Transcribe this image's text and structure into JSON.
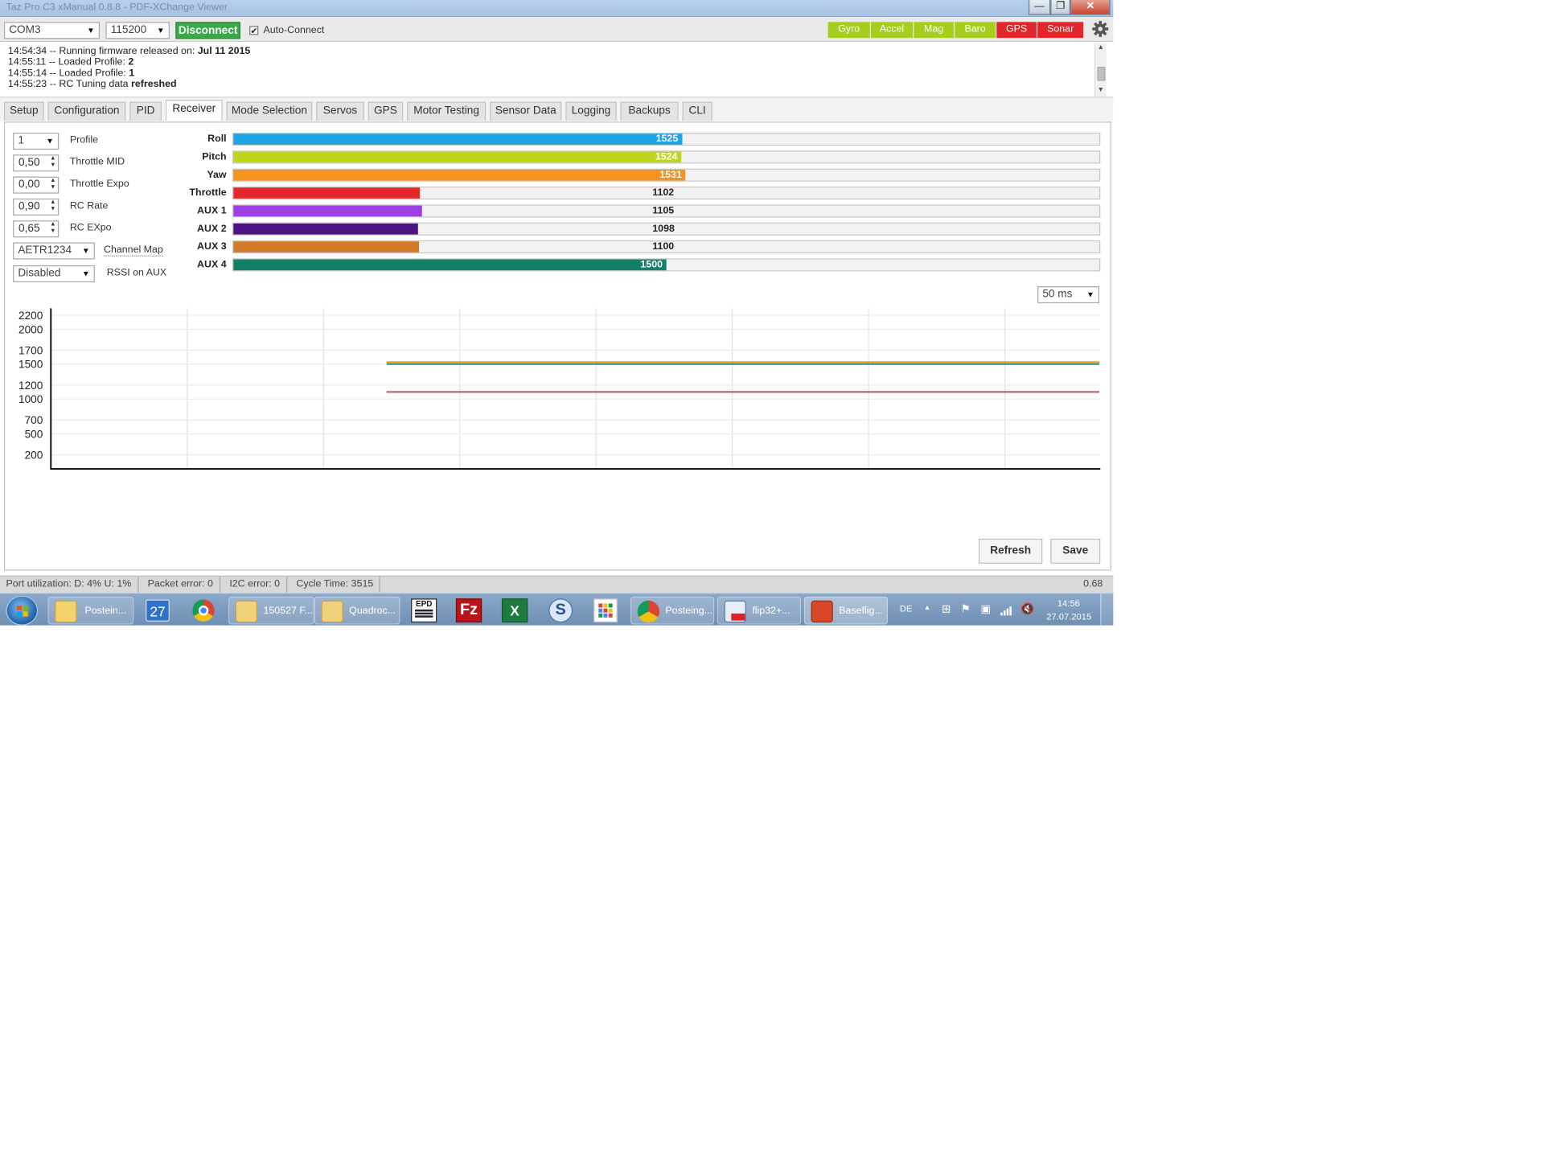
{
  "window": {
    "title": "Taz Pro C3 xManual 0.8.8 - PDF-XChange Viewer",
    "min_label": "—",
    "max_label": "❐",
    "close_label": "✕"
  },
  "toolbar": {
    "port": "COM3",
    "baud": "115200",
    "disconnect_label": "Disconnect",
    "autoconnect_label": "Auto-Connect",
    "autoconnect_checked": "✔",
    "sensors": [
      {
        "label": "Gyro",
        "state": "on",
        "color": "#a5cf1c"
      },
      {
        "label": "Accel",
        "state": "on",
        "color": "#a5cf1c"
      },
      {
        "label": "Mag",
        "state": "on",
        "color": "#a5cf1c"
      },
      {
        "label": "Baro",
        "state": "on",
        "color": "#a5cf1c"
      },
      {
        "label": "GPS",
        "state": "off",
        "color": "#e2262a"
      },
      {
        "label": "Sonar",
        "state": "off",
        "color": "#e2262a"
      }
    ],
    "settings_icon": "gear-icon"
  },
  "log": {
    "lines": [
      {
        "text": "14:54:34 -- Running firmware released on: ",
        "bold": "Jul 11 2015"
      },
      {
        "text": "14:55:11 -- Loaded Profile: ",
        "bold": "2"
      },
      {
        "text": "14:55:14 -- Loaded Profile: ",
        "bold": "1"
      },
      {
        "text": "14:55:23 -- RC Tuning data ",
        "bold": "refreshed"
      }
    ]
  },
  "tabs": [
    {
      "label": "Setup",
      "active": false
    },
    {
      "label": "Configuration",
      "active": false
    },
    {
      "label": "PID",
      "active": false
    },
    {
      "label": "Receiver",
      "active": true
    },
    {
      "label": "Mode Selection",
      "active": false
    },
    {
      "label": "Servos",
      "active": false
    },
    {
      "label": "GPS",
      "active": false
    },
    {
      "label": "Motor Testing",
      "active": false
    },
    {
      "label": "Sensor Data",
      "active": false
    },
    {
      "label": "Logging",
      "active": false
    },
    {
      "label": "Backups",
      "active": false
    },
    {
      "label": "CLI",
      "active": false
    }
  ],
  "settings": {
    "profile": {
      "value": "1",
      "label": "Profile"
    },
    "throttle_mid": {
      "value": "0,50",
      "label": "Throttle MID"
    },
    "throttle_expo": {
      "value": "0,00",
      "label": "Throttle Expo"
    },
    "rc_rate": {
      "value": "0,90",
      "label": "RC Rate"
    },
    "rc_expo": {
      "value": "0,65",
      "label": "RC EXpo"
    },
    "channel_map": {
      "value": "AETR1234",
      "label": "Channel Map"
    },
    "rssi": {
      "value": "Disabled",
      "label": "RSSI on AUX"
    }
  },
  "channels": {
    "min": 1000,
    "max": 2000,
    "items": [
      {
        "label": "Roll",
        "value": 1525,
        "color": "#1ea3e3"
      },
      {
        "label": "Pitch",
        "value": 1524,
        "color": "#c0d51a"
      },
      {
        "label": "Yaw",
        "value": 1531,
        "color": "#f6931e"
      },
      {
        "label": "Throttle",
        "value": 1102,
        "color": "#e5292b"
      },
      {
        "label": "AUX 1",
        "value": 1105,
        "color": "#9b3fe0"
      },
      {
        "label": "AUX 2",
        "value": 1098,
        "color": "#4a1580"
      },
      {
        "label": "AUX 3",
        "value": 1100,
        "color": "#d07a2a"
      },
      {
        "label": "AUX 4",
        "value": 1500,
        "color": "#14806a"
      }
    ]
  },
  "refresh_rate": "50 ms",
  "chart_data": {
    "type": "line",
    "title": "",
    "xlabel": "",
    "ylabel": "",
    "y_ticks": [
      "2200",
      "2000",
      "1700",
      "1500",
      "1200",
      "1000",
      "700",
      "500",
      "200"
    ],
    "ylim": [
      0,
      2300
    ],
    "grid": true,
    "x_start_fraction": 0.32,
    "series": [
      {
        "label": "Roll",
        "color": "#1ea3e3",
        "value": 1525
      },
      {
        "label": "Pitch",
        "color": "#c0d51a",
        "value": 1524
      },
      {
        "label": "Yaw",
        "color": "#f6931e",
        "value": 1531
      },
      {
        "label": "Throttle",
        "color": "#e5292b",
        "value": 1102
      },
      {
        "label": "AUX 1",
        "color": "#9b3fe0",
        "value": 1105
      },
      {
        "label": "AUX 2",
        "color": "#4a1580",
        "value": 1098
      },
      {
        "label": "AUX 3",
        "color": "#d07a2a",
        "value": 1100
      },
      {
        "label": "AUX 4",
        "color": "#14806a",
        "value": 1500
      }
    ]
  },
  "buttons": {
    "refresh": "Refresh",
    "save": "Save"
  },
  "status": {
    "port_util": "Port utilization: D: 4% U: 1%",
    "packet_error": "Packet error: 0",
    "i2c_error": "I2C error: 0",
    "cycle_time": "Cycle Time: 3515",
    "version": "0.68"
  },
  "taskbar": {
    "items": [
      {
        "label": "Postein...",
        "icon": "outlook-icon"
      },
      {
        "label": "150527 F...",
        "icon": "folder-icon"
      },
      {
        "label": "Quadroc...",
        "icon": "folder-icon"
      },
      {
        "label": "Posteing...",
        "icon": "chrome-icon"
      },
      {
        "label": "flip32+...",
        "icon": "pdf-icon"
      },
      {
        "label": "Baseflig...",
        "icon": "baseflight-icon"
      }
    ],
    "calendar_day": "27",
    "lang": "DE",
    "time": "14:56",
    "date": "27.07.2015"
  }
}
